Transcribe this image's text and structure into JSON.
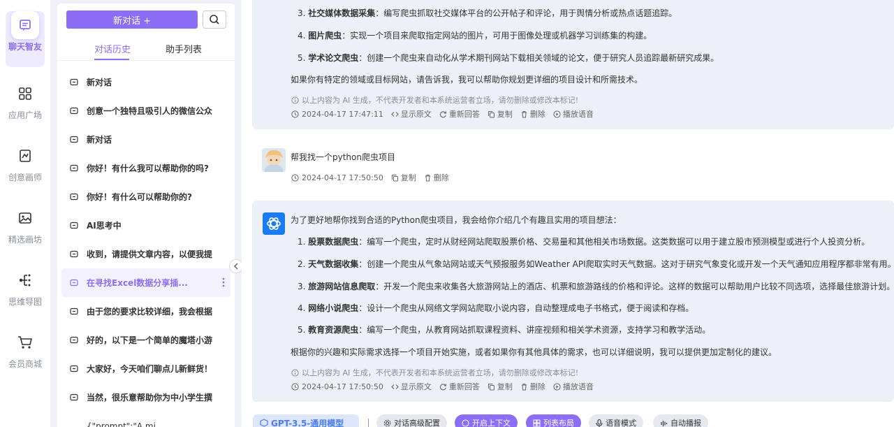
{
  "nav": {
    "items": [
      {
        "label": "聊天智友",
        "icon": "chat-icon"
      },
      {
        "label": "应用广场",
        "icon": "grid-icon"
      },
      {
        "label": "创意画师",
        "icon": "paint-icon"
      },
      {
        "label": "精选画坊",
        "icon": "gallery-icon"
      },
      {
        "label": "思维导图",
        "icon": "mindmap-icon"
      },
      {
        "label": "会员商城",
        "icon": "cart-icon"
      }
    ]
  },
  "sidebar": {
    "new_chat_label": "新对话 +",
    "tabs": [
      "对话历史",
      "助手列表"
    ],
    "history": [
      "新对话",
      "创意一个独特且吸引人的微信公众",
      "新对话",
      "你好！有什么我可以帮助你的吗?",
      "你好！有什么可以帮助你的?",
      "AI思考中",
      "收到，请提供文章内容，以便我提",
      "在寻找Excel数据分享插...",
      "由于您的要求比较详细，我会根据",
      "好的，以下是一个简单的魔塔小游",
      "大家好，今天咱们聊点儿新鲜货！",
      "当然，很乐意帮助你为中小学生撰",
      "{\"prompt\":\"A mi"
    ]
  },
  "chat": {
    "msg1": {
      "items": [
        {
          "num": "3.",
          "title": "社交媒体数据采集",
          "text": "：编写爬虫抓取社交媒体平台的公开帖子和评论，用于舆情分析或热点话题追踪。"
        },
        {
          "num": "4.",
          "title": "图片爬虫",
          "text": "：实现一个项目来爬取指定网站的图片，可用于图像处理或机器学习训练集的构建。"
        },
        {
          "num": "5.",
          "title": "学术论文爬虫",
          "text": "：创建一个爬虫来自动化从学术期刊网站下载相关领域的论文，便于研究人员追踪最新研究成果。"
        }
      ],
      "closing": "如果你有特定的领域或目标网站，请告诉我，我可以帮助你规划更详细的项目设计和所需技术。",
      "notice": "以上内容为 AI 生成，不代表开发者和本系统运营者立场，请勿删除或修改本标记!",
      "time": "2024-04-17 17:47:11"
    },
    "user_msg": {
      "text": "帮我找一个python爬虫项目",
      "time": "2024-04-17 17:50:50"
    },
    "msg2": {
      "intro": "为了更好地帮你找到合适的Python爬虫项目，我会给你介绍几个有趣且实用的项目想法：",
      "items": [
        {
          "num": "1.",
          "title": "股票数据爬虫",
          "text": "：编写一个爬虫，定时从财经网站爬取股票价格、交易量和其他相关市场数据。这类数据可以用于建立股市预测模型或进行个人投资分析。"
        },
        {
          "num": "2.",
          "title": "天气数据收集",
          "text": "：创建一个爬虫从气象站网站或天气预报服务如Weather API爬取实时天气数据。这对于研究气象变化或开发一个天气通知应用程序都非常有用。"
        },
        {
          "num": "3.",
          "title": "旅游网站信息爬取",
          "text": "：开发一个爬虫来收集各大旅游网站上的酒店、机票和旅游路线的价格和评论。这样的数据可以帮助用户比较不同选项，选择最佳旅游计划。"
        },
        {
          "num": "4.",
          "title": "网络小说爬虫",
          "text": "：设计一个爬虫从网络文学网站爬取小说内容，自动整理成电子书格式，便于阅读和存档。"
        },
        {
          "num": "5.",
          "title": "教育资源爬虫",
          "text": "：编写一个爬虫，从教育网站抓取课程资料、讲座视频和相关学术资源，支持学习和教学活动。"
        }
      ],
      "closing": "根据你的兴趣和实际需求选择一个项目开始实施，或者如果你有其他具体的需求，也可以详细说明，我可以提供更加定制化的建议。",
      "notice": "以上内容为 AI 生成，不代表开发者和本系统运营者立场，请勿删除或修改本标记!",
      "time": "2024-04-17 17:50:50"
    },
    "actions": {
      "show_source": "显示原文",
      "regenerate": "重新回答",
      "copy": "复制",
      "delete": "删除",
      "play": "播放语音"
    }
  },
  "toolbar": {
    "model": "GPT-3.5-通用模型",
    "settings": "对话高级配置",
    "context": "开启上下文",
    "layout": "列表布局",
    "voice_mode": "语音模式",
    "auto_play": "自动播报"
  },
  "colors": {
    "accent": "#8b6ef5",
    "card_bg": "#eef0f8",
    "page_bg": "#f0f1f6"
  }
}
